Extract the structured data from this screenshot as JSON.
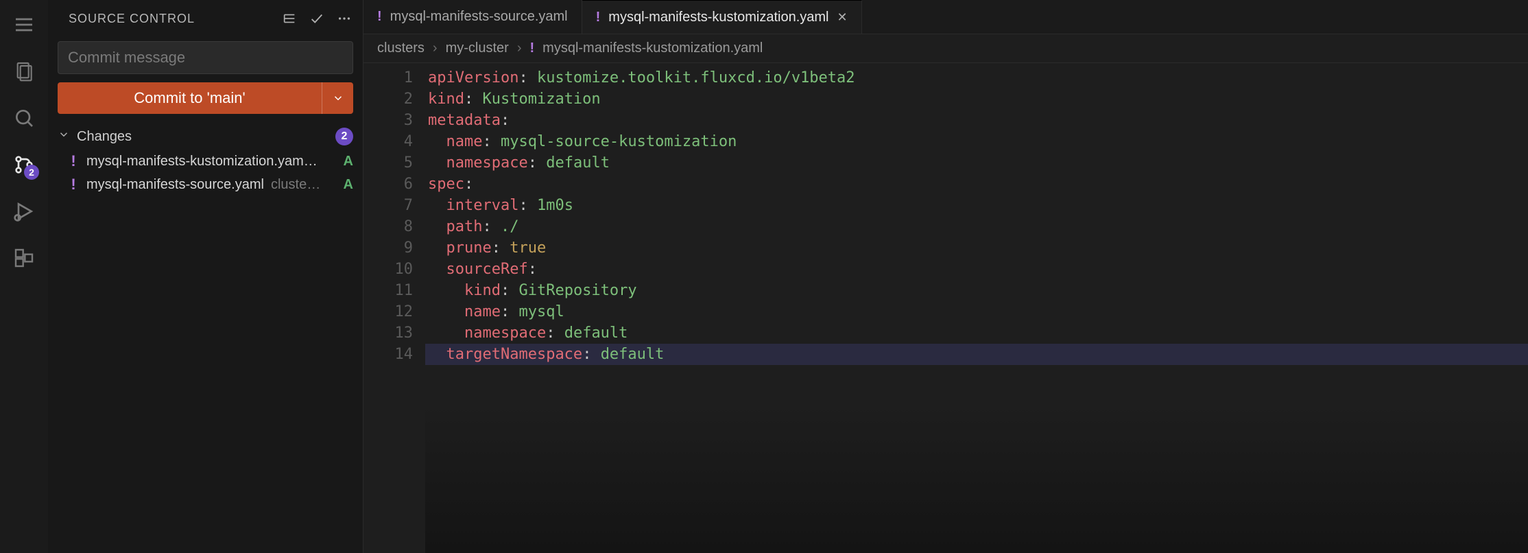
{
  "activity": {
    "badge_count": "2"
  },
  "sidebar": {
    "title": "SOURCE CONTROL",
    "commit_placeholder": "Commit message",
    "commit_button": "Commit to 'main'",
    "changes_label": "Changes",
    "changes_count": "2",
    "changes": [
      {
        "icon": "!",
        "name": "mysql-manifests-kustomization.yam…",
        "path": "",
        "status": "A"
      },
      {
        "icon": "!",
        "name": "mysql-manifests-source.yaml",
        "path": "cluste…",
        "status": "A"
      }
    ]
  },
  "tabs": [
    {
      "icon": "!",
      "label": "mysql-manifests-source.yaml",
      "active": false,
      "close": false
    },
    {
      "icon": "!",
      "label": "mysql-manifests-kustomization.yaml",
      "active": true,
      "close": true
    }
  ],
  "breadcrumbs": {
    "parts": [
      "clusters",
      "my-cluster"
    ],
    "file_icon": "!",
    "file": "mysql-manifests-kustomization.yaml"
  },
  "code": {
    "highlight_line": 14,
    "lines": [
      {
        "n": 1,
        "segs": [
          {
            "t": "apiVersion",
            "c": "k-key"
          },
          {
            "t": ": ",
            "c": "k-punc"
          },
          {
            "t": "kustomize.toolkit.fluxcd.io/v1beta2",
            "c": "k-str"
          }
        ]
      },
      {
        "n": 2,
        "segs": [
          {
            "t": "kind",
            "c": "k-key"
          },
          {
            "t": ": ",
            "c": "k-punc"
          },
          {
            "t": "Kustomization",
            "c": "k-str"
          }
        ]
      },
      {
        "n": 3,
        "segs": [
          {
            "t": "metadata",
            "c": "k-key"
          },
          {
            "t": ":",
            "c": "k-punc"
          }
        ]
      },
      {
        "n": 4,
        "segs": [
          {
            "t": "  ",
            "c": ""
          },
          {
            "t": "name",
            "c": "k-key"
          },
          {
            "t": ": ",
            "c": "k-punc"
          },
          {
            "t": "mysql-source-kustomization",
            "c": "k-str"
          }
        ]
      },
      {
        "n": 5,
        "segs": [
          {
            "t": "  ",
            "c": ""
          },
          {
            "t": "namespace",
            "c": "k-key"
          },
          {
            "t": ": ",
            "c": "k-punc"
          },
          {
            "t": "default",
            "c": "k-str"
          }
        ]
      },
      {
        "n": 6,
        "segs": [
          {
            "t": "spec",
            "c": "k-key"
          },
          {
            "t": ":",
            "c": "k-punc"
          }
        ]
      },
      {
        "n": 7,
        "segs": [
          {
            "t": "  ",
            "c": ""
          },
          {
            "t": "interval",
            "c": "k-key"
          },
          {
            "t": ": ",
            "c": "k-punc"
          },
          {
            "t": "1m0s",
            "c": "k-str"
          }
        ]
      },
      {
        "n": 8,
        "segs": [
          {
            "t": "  ",
            "c": ""
          },
          {
            "t": "path",
            "c": "k-key"
          },
          {
            "t": ": ",
            "c": "k-punc"
          },
          {
            "t": "./",
            "c": "k-str"
          }
        ]
      },
      {
        "n": 9,
        "segs": [
          {
            "t": "  ",
            "c": ""
          },
          {
            "t": "prune",
            "c": "k-key"
          },
          {
            "t": ": ",
            "c": "k-punc"
          },
          {
            "t": "true",
            "c": "k-bool"
          }
        ]
      },
      {
        "n": 10,
        "segs": [
          {
            "t": "  ",
            "c": ""
          },
          {
            "t": "sourceRef",
            "c": "k-key"
          },
          {
            "t": ":",
            "c": "k-punc"
          }
        ]
      },
      {
        "n": 11,
        "segs": [
          {
            "t": "    ",
            "c": ""
          },
          {
            "t": "kind",
            "c": "k-key"
          },
          {
            "t": ": ",
            "c": "k-punc"
          },
          {
            "t": "GitRepository",
            "c": "k-str"
          }
        ]
      },
      {
        "n": 12,
        "segs": [
          {
            "t": "    ",
            "c": ""
          },
          {
            "t": "name",
            "c": "k-key"
          },
          {
            "t": ": ",
            "c": "k-punc"
          },
          {
            "t": "mysql",
            "c": "k-str"
          }
        ]
      },
      {
        "n": 13,
        "segs": [
          {
            "t": "    ",
            "c": ""
          },
          {
            "t": "namespace",
            "c": "k-key"
          },
          {
            "t": ": ",
            "c": "k-punc"
          },
          {
            "t": "default",
            "c": "k-str"
          }
        ]
      },
      {
        "n": 14,
        "segs": [
          {
            "t": "  ",
            "c": ""
          },
          {
            "t": "targetNamespace",
            "c": "k-key"
          },
          {
            "t": ": ",
            "c": "k-punc"
          },
          {
            "t": "default",
            "c": "k-str"
          }
        ]
      }
    ]
  }
}
